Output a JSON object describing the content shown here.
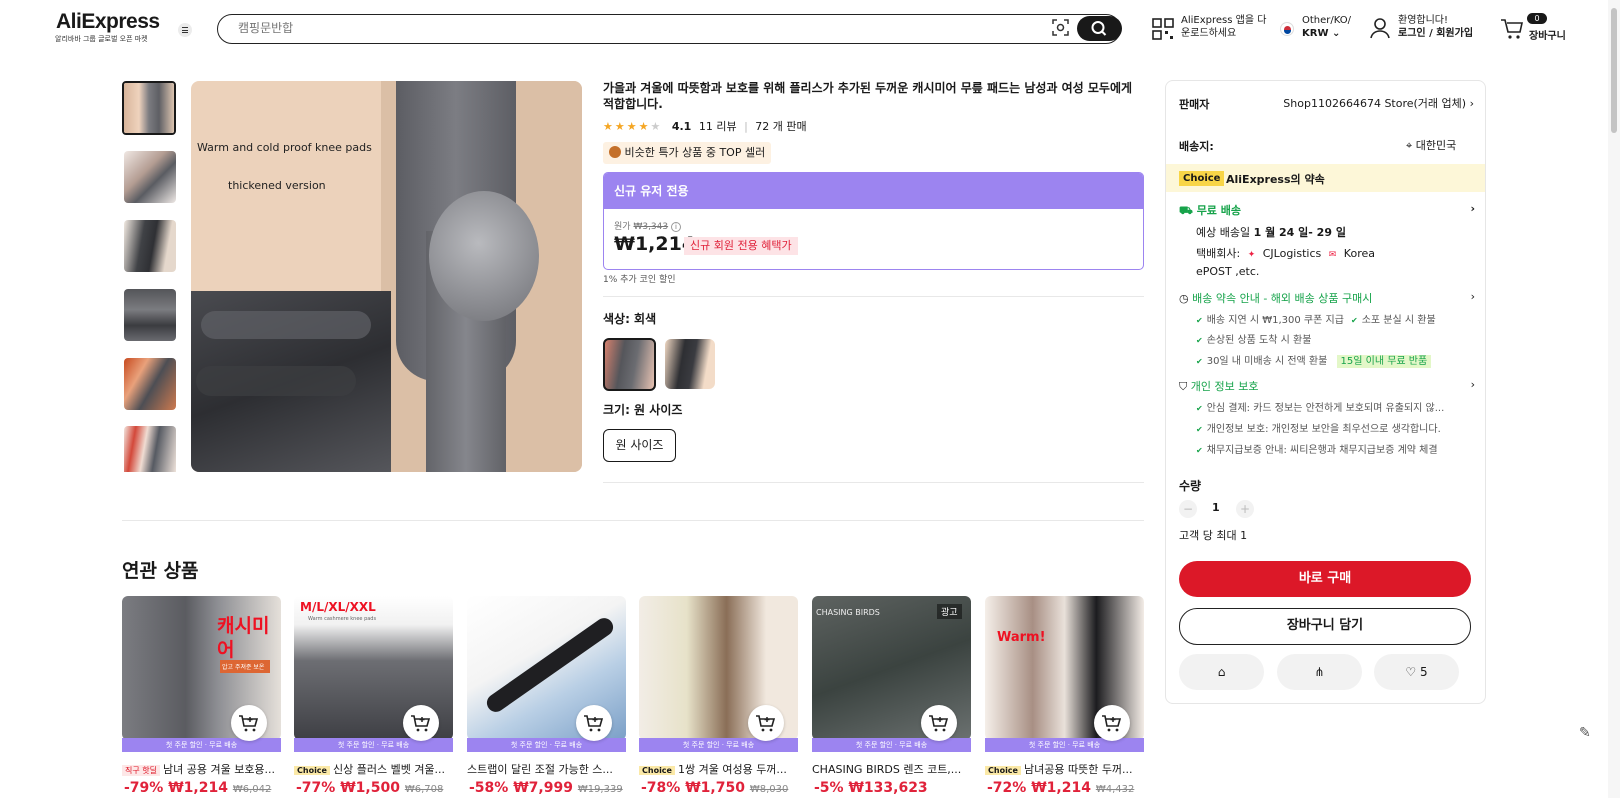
{
  "header": {
    "logo": "AliExpress",
    "logo_sub": "알리바바 그룹 글로벌 오픈 마켓",
    "search_placeholder": "캠핑문반합",
    "app_download": [
      "AliExpress 앱을 다",
      "운로드하세요"
    ],
    "region_top": "Other/KO/",
    "currency": "KRW",
    "welcome": "환영합니다!",
    "login": "로그인 / 회원가입",
    "cart_count": "0",
    "cart_label": "장바구니"
  },
  "gallery": {
    "main_text_1": "Warm and cold proof knee pads",
    "main_text_2": "thickened version"
  },
  "product": {
    "title": "가을과 겨울에 따뜻함과 보호를 위해 플리스가 추가된 두꺼운 캐시미어 무릎 패드는 남성과 여성 모두에게 적합합니다.",
    "rating": "4.1",
    "reviews": "11 리뷰",
    "sold": "72 개 판매",
    "top_seller": "비슷한 특가 상품 중 TOP 셀러",
    "promo_header": "신규 유저 전용",
    "orig_label": "원가",
    "orig_price": "₩3,343",
    "price": "₩1,214",
    "price_badge": "신규 회원 전용 혜택가",
    "coin": "1% 추가 코인 할인",
    "color_label": "색상: 회색",
    "size_label": "크기: 원 사이즈",
    "size_option": "원 사이즈"
  },
  "side": {
    "seller_label": "판매자",
    "seller_name": "Shop1102664674 Store(거래 업체)",
    "ship_to_label": "배송지:",
    "ship_to": "대한민국",
    "choice_tag": "Choice",
    "choice_promise": "AliExpress의 약속",
    "free_ship": "무료 배송",
    "eta_prefix": "예상 배송일 ",
    "eta": "1 월 24 일- 29 일",
    "carrier_label": "택배회사:",
    "carrier_1": "CJLogistics",
    "carrier_2": "Korea",
    "carrier_3": "ePOST ,etc.",
    "promise_title": "배송 약속 안내 - 해외 배송 상품 구매시",
    "promise_1": "배송 지연 시 ₩1,300 쿠폰 지급",
    "promise_2": "소포 분실 시 환불",
    "promise_3": "손상된 상품 도착 시 환불",
    "promise_4": "30일 내 미배송 시 전액 환불",
    "promise_4_badge": "15일 이내 무료 반품",
    "privacy_title": "개인 정보 보호",
    "privacy_1": "안심 결제: 카드 정보는 안전하게 보호되며 유출되지 않...",
    "privacy_2": "개인정보 보호: 개인정보 보안을 최우선으로 생각합니다.",
    "privacy_3": "채무지급보증 안내: 씨티은행과 채무지급보증 계약 체결",
    "qty_label": "수량",
    "qty": "1",
    "qty_limit": "고객 당 최대 1",
    "buy_now": "바로 구매",
    "add_cart": "장바구니 담기",
    "wish_count": "5"
  },
  "related": {
    "title": "연관 상품",
    "strip": "첫 주문 할인 · 무료 배송",
    "items": [
      {
        "tag": "직구 핫딜",
        "title": "남녀 공용 겨울 보호용...",
        "discount": "-79%",
        "price": "₩1,214",
        "orig": "₩6,042",
        "img_text": "캐시미어",
        "img_sub": "압고 주져준 보온"
      },
      {
        "tag": "Choice",
        "title": "신상 플러스 벨벳 겨울...",
        "discount": "-77%",
        "price": "₩1,500",
        "orig": "₩6,708",
        "img_text": "M/L/XL/XXL",
        "img_sub": "Warm cashmere knee pads"
      },
      {
        "tag": "",
        "title": "스트랩이 달린 조절 가능한 스...",
        "discount": "-58%",
        "price": "₩7,999",
        "orig": "₩19,339",
        "img_text": "",
        "img_sub": ""
      },
      {
        "tag": "Choice",
        "title": "1쌍 겨울 여성용 두꺼...",
        "discount": "-78%",
        "price": "₩1,750",
        "orig": "₩8,030",
        "img_text": "",
        "img_sub": ""
      },
      {
        "tag": "",
        "title": "CHASING BIRDS 렌즈 코트,...",
        "discount": "-5%",
        "price": "₩133,623",
        "orig": "",
        "img_text": "CHASING BIRDS",
        "img_sub": "광고"
      },
      {
        "tag": "Choice",
        "title": "남녀공용 따뜻한 두꺼...",
        "discount": "-72%",
        "price": "₩1,214",
        "orig": "₩4,432",
        "img_text": "Warm!",
        "img_sub": ""
      }
    ]
  },
  "colors": {
    "accent_red": "#dc1828",
    "promo_purple": "#9c84f0",
    "green": "#16a34a",
    "choice_yellow": "#fbe9a7"
  }
}
